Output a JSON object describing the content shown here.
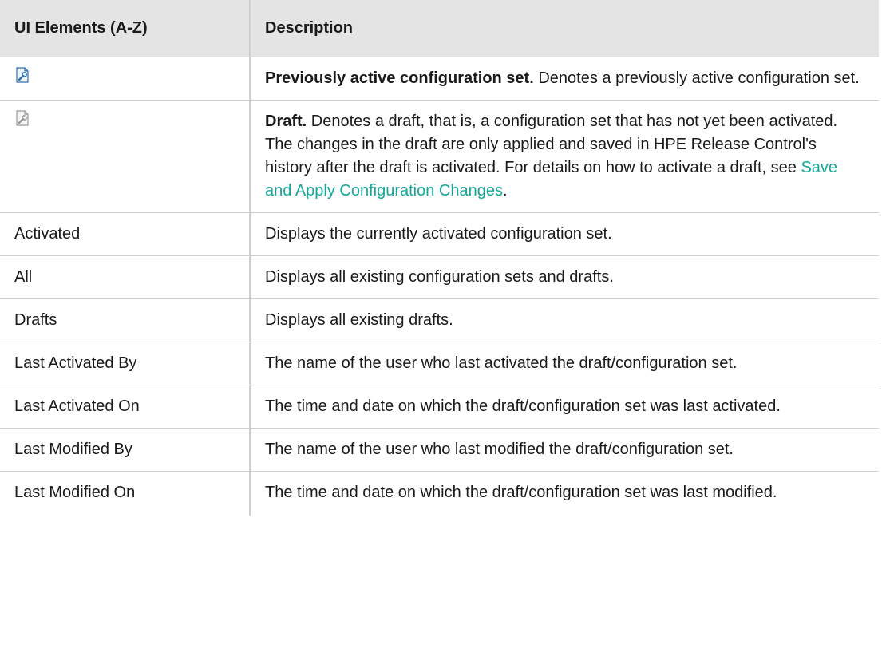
{
  "table": {
    "headers": {
      "col1": "UI Elements (A-Z)",
      "col2": "Description"
    },
    "rows": [
      {
        "icon": "previously-active-configuration-set-icon",
        "term": "Previously active configuration set.",
        "text": " Denotes a previously active configuration set."
      },
      {
        "icon": "draft-icon",
        "term": "Draft.",
        "text": " Denotes a draft, that is, a configuration set that has not yet been activated. The changes in the draft are only applied and saved in HPE Release Control's history after the draft is activated. For details on how to activate a draft, see ",
        "link": "Save and Apply Configuration Changes",
        "after": "."
      },
      {
        "element": "Activated",
        "description": "Displays the currently activated configuration set."
      },
      {
        "element": "All",
        "description": "Displays all existing configuration sets and drafts."
      },
      {
        "element": "Drafts",
        "description": "Displays all existing drafts."
      },
      {
        "element": "Last Activated By",
        "description": "The name of the user who last activated the draft/configuration set."
      },
      {
        "element": "Last Activated On",
        "description": "The time and date on which the draft/configuration set was last activated."
      },
      {
        "element": "Last Modified By",
        "description": "The name of the user who last modified the draft/configuration set."
      },
      {
        "element": "Last Modified On",
        "description": "The time and date on which the draft/configuration set was last modified."
      }
    ]
  },
  "colors": {
    "header_bg": "#e4e4e4",
    "border": "#cfcfcf",
    "link": "#12a89a",
    "icon_active": "#2f6fb0",
    "icon_draft": "#9a9a9a"
  }
}
